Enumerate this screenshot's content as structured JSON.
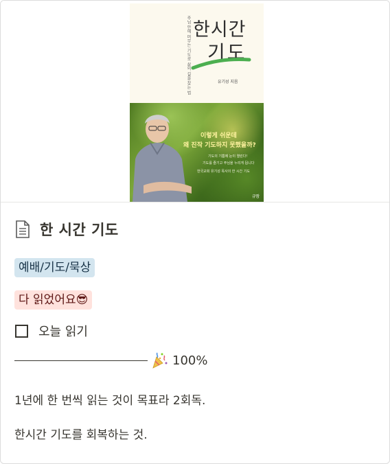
{
  "cover": {
    "book_title_line1": "한시간",
    "book_title_line2": "기도",
    "book_subtitle": "주님 안에 머무는 기도로 삶의 길을 찾는 법",
    "book_author": "유기성 지음",
    "photo_headline_1": "이렇게 쉬운데",
    "photo_headline_2": "왜 진작 기도하지 못했을까?",
    "photo_small_1": "기도의 기쁨에 눈이 열린다!",
    "photo_small_2": "기도를 즐기고 주님을 누리게 됩니다",
    "photo_small_3": "한국교회 유기성 목사의 한 시간 기도",
    "publisher": "규장"
  },
  "page": {
    "icon": "page-icon",
    "title": "한 시간 기도"
  },
  "tags": {
    "category": "예배/기도/묵상",
    "status": "다 읽었어요😎"
  },
  "todo": {
    "label": "오늘 읽기",
    "checked": false
  },
  "progress": {
    "bar": "────────────",
    "emoji_icon": "party-popper-icon",
    "text": "100%",
    "value": 1.0
  },
  "notes": {
    "line1": "1년에 한 번씩 읽는 것이 목표라 2회독.",
    "line2": "한시간 기도를 회복하는 것."
  },
  "colors": {
    "text": "#37352f",
    "tag_blue_bg": "#d3e5ef",
    "tag_red_bg": "#ffe2dd",
    "brush_green": "#4caf50"
  }
}
